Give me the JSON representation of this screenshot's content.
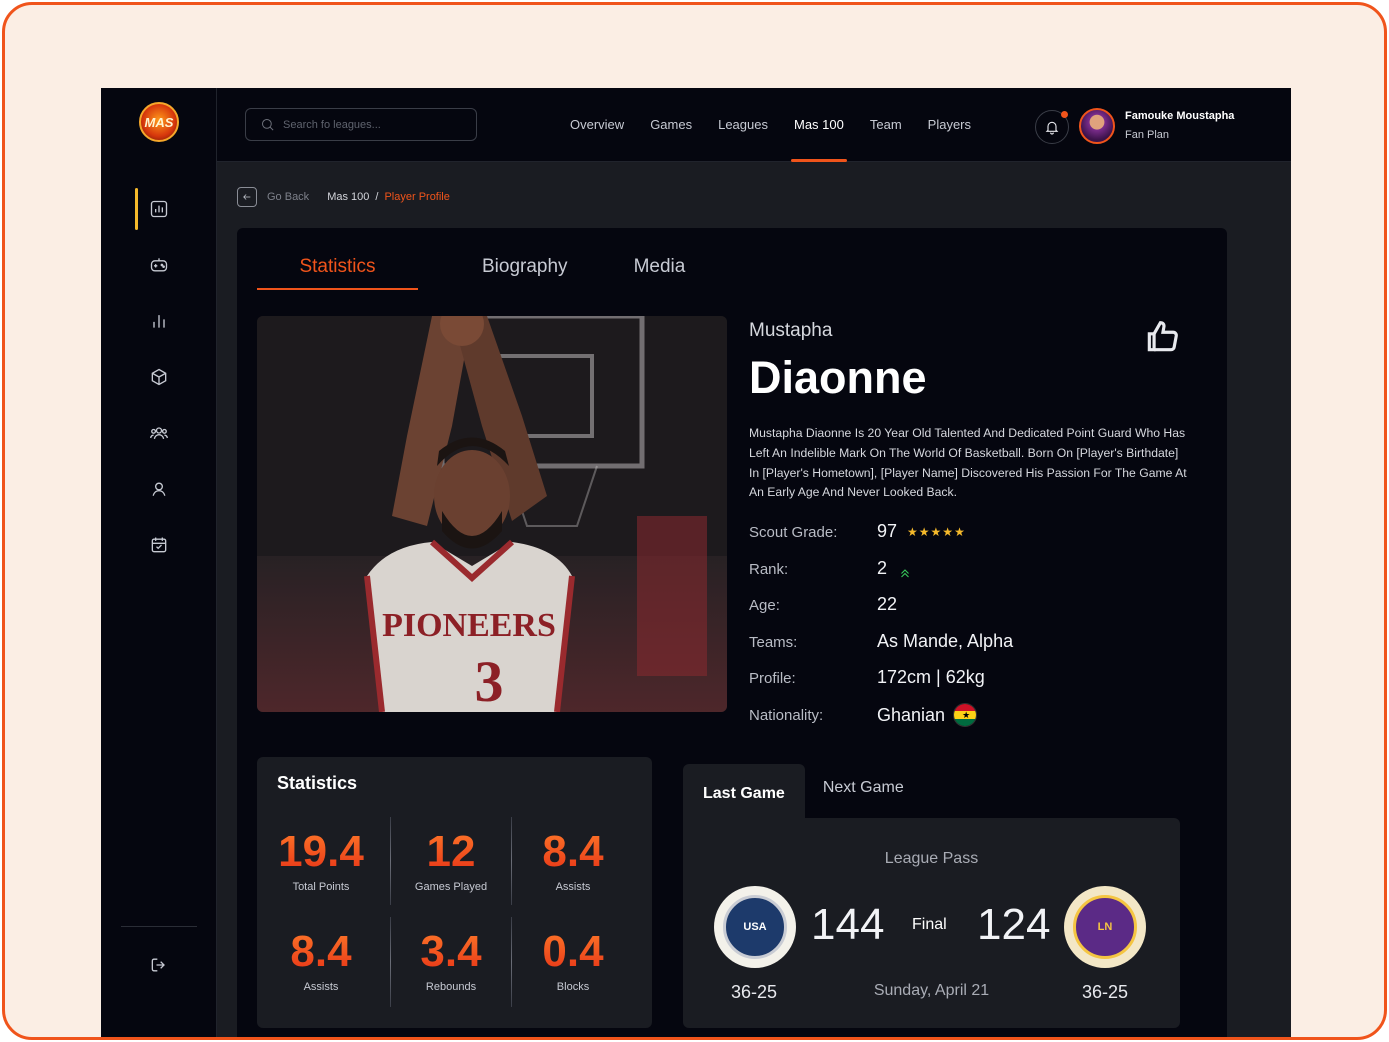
{
  "app": {
    "logo_text": "MAS"
  },
  "search": {
    "placeholder": "Search fo leagues..."
  },
  "nav": {
    "items": [
      {
        "label": "Overview"
      },
      {
        "label": "Games"
      },
      {
        "label": "Leagues"
      },
      {
        "label": "Mas 100",
        "active": true
      },
      {
        "label": "Team"
      },
      {
        "label": "Players"
      }
    ]
  },
  "user": {
    "name": "Famouke Moustapha",
    "plan": "Fan Plan"
  },
  "sidebar": {
    "items": [
      {
        "icon": "dashboard-icon",
        "active": true
      },
      {
        "icon": "gamepad-icon"
      },
      {
        "icon": "bar-chart-icon"
      },
      {
        "icon": "basketball-icon"
      },
      {
        "icon": "team-icon"
      },
      {
        "icon": "player-icon"
      },
      {
        "icon": "calendar-icon"
      }
    ],
    "logout_icon": "logout-icon"
  },
  "breadcrumb": {
    "back_label": "Go Back",
    "level1": "Mas 100",
    "separator": "/",
    "current": "Player Profile"
  },
  "tabs": [
    {
      "label": "Statistics",
      "active": true
    },
    {
      "label": "Biography"
    },
    {
      "label": "Media"
    }
  ],
  "player": {
    "first_name": "Mustapha",
    "last_name": "Diaonne",
    "bio": "Mustapha Diaonne Is 20 Year Old  Talented And Dedicated Point Guard Who Has Left An Indelible Mark On The World Of Basketball. Born On [Player's Birthdate] In [Player's Hometown], [Player Name] Discovered His Passion For The Game At An Early Age And Never Looked Back.",
    "jersey": {
      "team_text": "PIONEERS",
      "number": "3"
    },
    "info": {
      "scout_grade": {
        "label": "Scout Grade:",
        "value": "97",
        "stars": "★★★★★"
      },
      "rank": {
        "label": "Rank:",
        "value": "2"
      },
      "age": {
        "label": "Age:",
        "value": "22"
      },
      "teams": {
        "label": "Teams:",
        "value": "As Mande, Alpha"
      },
      "profile": {
        "label": "Profile:",
        "value": "172cm | 62kg"
      },
      "nationality": {
        "label": "Nationality:",
        "value": "Ghanian"
      }
    }
  },
  "statistics": {
    "title": "Statistics",
    "items": [
      {
        "value": "19.4",
        "label": "Total Points"
      },
      {
        "value": "12",
        "label": "Games Played"
      },
      {
        "value": "8.4",
        "label": "Assists"
      },
      {
        "value": "8.4",
        "label": "Assists"
      },
      {
        "value": "3.4",
        "label": "Rebounds"
      },
      {
        "value": "0.4",
        "label": "Blocks"
      }
    ]
  },
  "game": {
    "tabs": [
      {
        "label": "Last Game",
        "active": true
      },
      {
        "label": "Next Game"
      }
    ],
    "league": "League Pass",
    "home": {
      "logo_text": "USA",
      "score": "144",
      "record": "36-25"
    },
    "away": {
      "logo_text": "LN",
      "score": "124",
      "record": "36-25"
    },
    "status": "Final",
    "date": "Sunday, April 21"
  },
  "colors": {
    "accent": "#f0541b",
    "gold": "#f5b92b",
    "background": "#05060f",
    "panel": "#1a1c22"
  }
}
